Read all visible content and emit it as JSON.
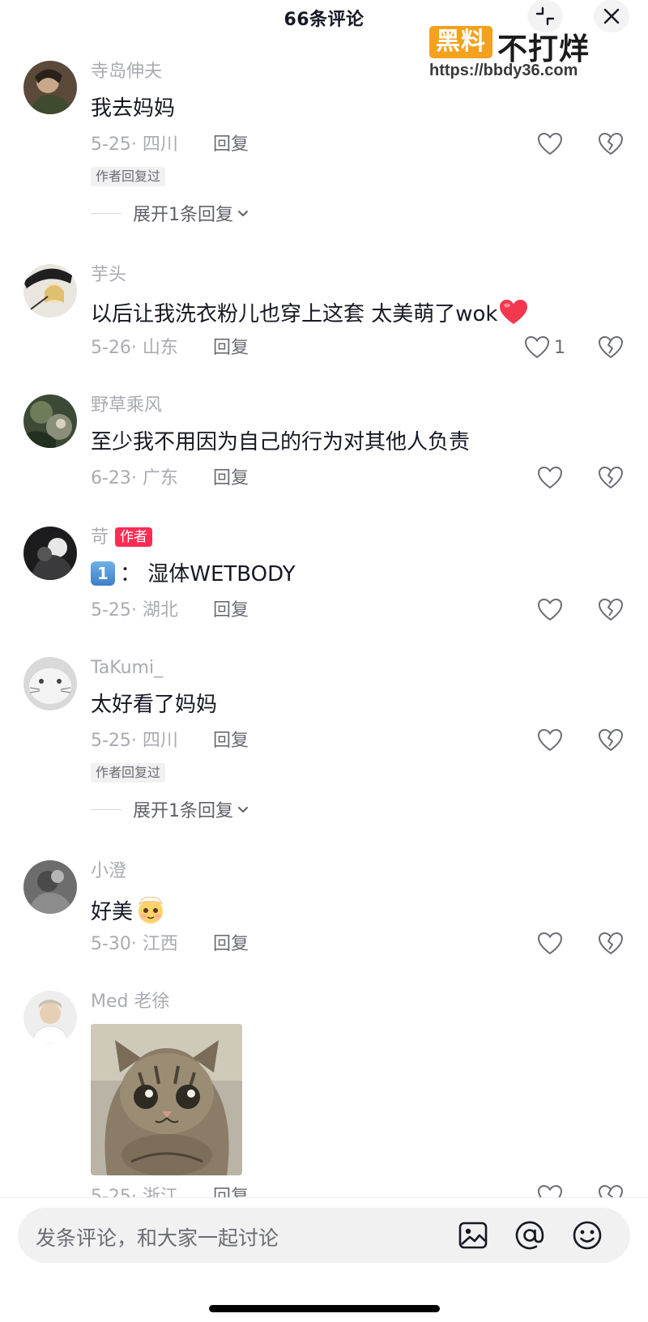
{
  "header": {
    "title": "66条评论",
    "collapse_icon": "collapse-icon",
    "close_icon": "close-icon"
  },
  "watermark": {
    "badge": "黑料",
    "text": "不打烊",
    "url": "https://bbdy36.com"
  },
  "labels": {
    "reply": "回复",
    "author_replied": "作者回复过",
    "author_tag": "作者"
  },
  "comments": [
    {
      "username": "寺岛伸夫",
      "text": "我去妈妈",
      "date_location": "5-25· 四川",
      "likes": "",
      "author_replied": true,
      "expand": "展开1条回复"
    },
    {
      "username": "芋头",
      "text": "以后让我洗衣粉儿也穿上这套 太美萌了wok",
      "date_location": "5-26· 山东",
      "likes": "1"
    },
    {
      "username": "野草乘风",
      "text": "至少我不用因为自己的行为对其他人负责",
      "date_location": "6-23· 广东",
      "likes": ""
    },
    {
      "username": "苛",
      "is_author": true,
      "number_emoji": "1",
      "text": "：  湿体WETBODY",
      "date_location": "5-25· 湖北",
      "likes": ""
    },
    {
      "username": "TaKumi_",
      "text": "太好看了妈妈",
      "date_location": "5-25· 四川",
      "likes": "",
      "author_replied": true,
      "expand": "展开1条回复"
    },
    {
      "username": "小澄",
      "text": "好美",
      "date_location": "5-30· 江西",
      "likes": ""
    },
    {
      "username": "Med 老徐",
      "text": "",
      "date_location": "5-25· 浙江",
      "likes": "",
      "has_image": true
    }
  ],
  "input": {
    "placeholder": "发条评论，和大家一起讨论"
  },
  "colors": {
    "accent": "#fe2c55",
    "secondary_text": "#a9abb1",
    "primary_text": "#161823",
    "watermark_badge": "#f4a11d"
  }
}
